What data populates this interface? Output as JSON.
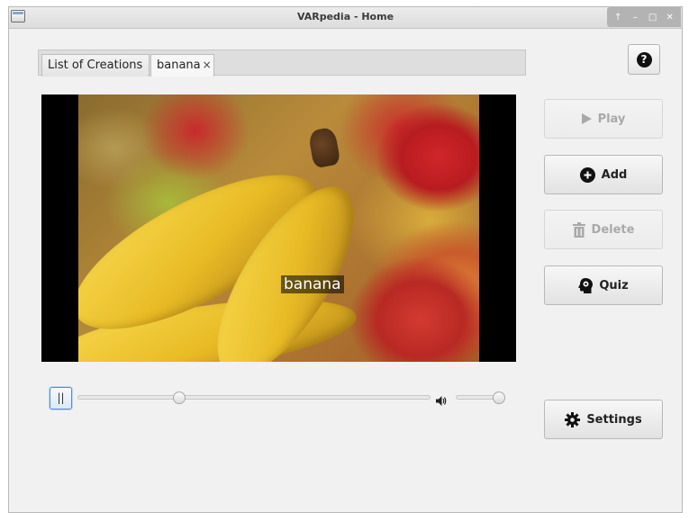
{
  "window": {
    "title": "VARpedia - Home",
    "controls": [
      "up-arrow-icon",
      "minimize-icon",
      "maximize-icon",
      "close-icon"
    ]
  },
  "tabs": [
    {
      "label": "List of Creations",
      "selected": false
    },
    {
      "label": "banana",
      "selected": true,
      "closable": true,
      "close_glyph": "×"
    }
  ],
  "help": {
    "label": "?"
  },
  "media": {
    "subtitle": "banana",
    "image_subject": "bananas and apples"
  },
  "controls": {
    "pause_label": "||",
    "seek_fraction": 0.28,
    "volume_fraction": 1.0
  },
  "buttons": {
    "play": {
      "label": "Play",
      "enabled": false,
      "icon": "play-icon"
    },
    "add": {
      "label": "Add",
      "enabled": true,
      "icon": "plus-circle-icon"
    },
    "delete": {
      "label": "Delete",
      "enabled": false,
      "icon": "trash-icon"
    },
    "quiz": {
      "label": "Quiz",
      "enabled": true,
      "icon": "brain-head-icon"
    },
    "settings": {
      "label": "Settings",
      "enabled": true,
      "icon": "gear-icon"
    }
  }
}
